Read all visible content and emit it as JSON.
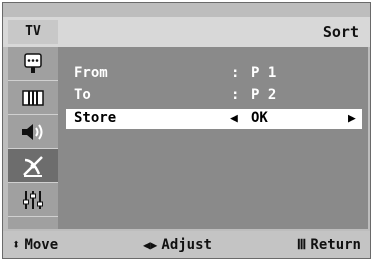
{
  "header": {
    "mode_label": "TV",
    "title": "Sort"
  },
  "sidebar": {
    "items": [
      {
        "icon": "input-icon"
      },
      {
        "icon": "picture-icon"
      },
      {
        "icon": "sound-icon"
      },
      {
        "icon": "channel-icon",
        "active": true
      },
      {
        "icon": "setup-icon"
      }
    ]
  },
  "menu": {
    "rows": [
      {
        "label": "From",
        "sep": ":",
        "value": "P 1"
      },
      {
        "label": "To",
        "sep": ":",
        "value": "P 2"
      },
      {
        "label": "Store",
        "value": "OK",
        "selected": true
      }
    ]
  },
  "footer": {
    "move_glyph": "⬍",
    "move": "Move",
    "adjust_glyph": "◀▶",
    "adjust": "Adjust",
    "return_glyph": "Ⅲ",
    "return": "Return"
  }
}
